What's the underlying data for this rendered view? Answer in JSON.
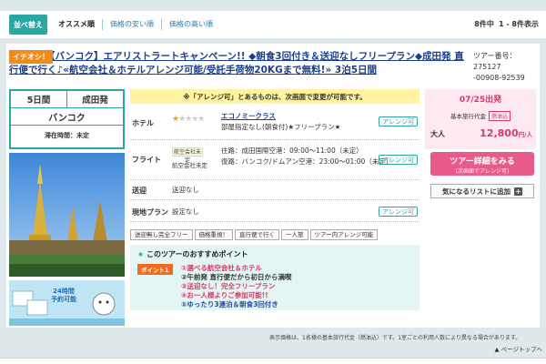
{
  "sort": {
    "button_label": "並べ替え",
    "tabs": [
      "オススメ順",
      "価格の安い順",
      "価格の高い順"
    ]
  },
  "result_count": {
    "total": "8件中",
    "range": "1 - 8件表示"
  },
  "tour": {
    "badge": "イチオシ！",
    "title": "【バンコク】エアリストラートキャンペーン!! ◆朝食3回付き＆送迎なしフリープラン◆成田発 直行便で行く♪«航空会社＆ホテルアレンジ可能/受託手荷物20KGまで無料!» 3泊5日間",
    "tour_number_label": "ツアー番号：275127",
    "tour_number_code": "-00908-92539"
  },
  "summary": {
    "duration": "5日間",
    "departure": "成田発",
    "destination": "バンコク",
    "stay_time": "滞在時間：未定"
  },
  "notice": "※「アレンジ可」とあるものは、次画面で変更が可能です。",
  "hotel": {
    "label": "ホテル",
    "rating": 1,
    "max_rating": 5,
    "name": "エコノミークラス",
    "desc": "部屋指定なし(朝食付)★フリープラン★",
    "arrange": "アレンジ可"
  },
  "flight": {
    "label": "フライト",
    "airline_logo": "航空会社未定",
    "airline_text": "航空会社未定",
    "outbound": "往路：成田国際空港：09:00～11:00（未定）",
    "return": "復路：バンコク/ドムアン空港：23:00～01:00（未定）",
    "arrange": "アレンジ可"
  },
  "transfer": {
    "label": "送迎",
    "value": "送迎なし"
  },
  "local_plan": {
    "label": "現地プラン",
    "value": "設定なし",
    "arrange": "アレンジ可"
  },
  "tags": [
    "送迎無し完全フリー",
    "価格重視！",
    "直行便で行く",
    "一人旅",
    "ツアー内アレンジ可能"
  ],
  "recommend": {
    "title": "このツアーのおすすめポイント",
    "point_label": "ポイント1",
    "lines": [
      "①選べる航空会社＆ホテル",
      "②午前発 直行便だから初日から満喫",
      "③送迎なし！完全フリープラン",
      "④お一人様よりご参加可能!!",
      "⑤ゆったり3連泊＆朝食3回付き"
    ]
  },
  "banner": {
    "text1": "24時間",
    "text2": "予約可能"
  },
  "price": {
    "date": "07/25出発",
    "basic_label": "基本旅行代金",
    "fuel_tag": "燃油込",
    "adult_label": "大人",
    "amount": "12,800",
    "unit": "円/人"
  },
  "buttons": {
    "detail_main": "ツアー詳細をみる",
    "detail_sub": "(次画面でアレンジ可)",
    "favorite": "気になるリストに追加"
  },
  "footnote": "表示価格は、1名様の基本旅行代金（燃油込）です。1室ごとの利用人数により異なる場合があります。",
  "pagetop": "ページトップへ",
  "colors": {
    "accent": "#29a6a2",
    "price": "#d43a6a",
    "badge": "#f08a1a"
  }
}
